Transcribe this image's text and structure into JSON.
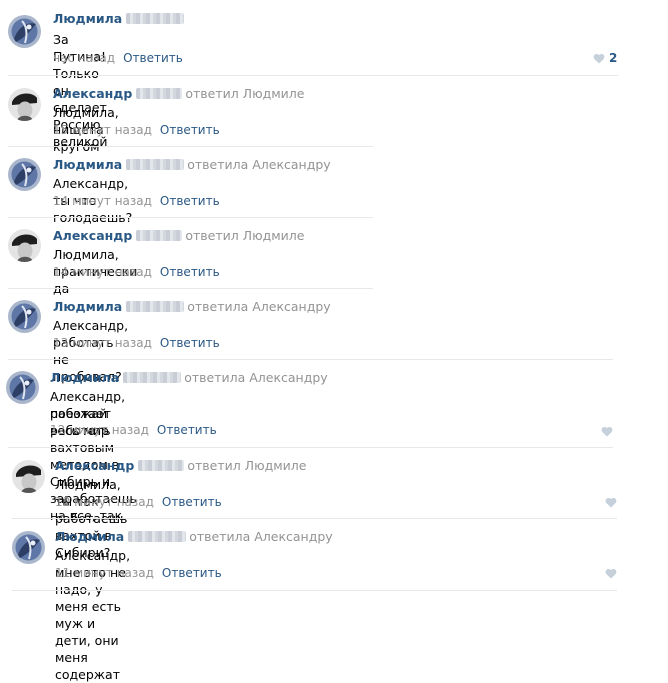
{
  "comments": [
    {
      "author": "Людмила",
      "reply_to": "",
      "text": "За Путина! Только он сделает Россию великой",
      "time": "час назад",
      "reply_label": "Ответить",
      "likes": "2",
      "avatar": "ludmila-avatar"
    },
    {
      "author": "Александр",
      "reply_to": "ответил Людмиле",
      "text": "Людмила, нищета кругом",
      "time": "15 минут назад",
      "reply_label": "Ответить",
      "avatar": "alexander-avatar"
    },
    {
      "author": "Людмила",
      "reply_to": "ответила Александру",
      "text": "Александр, ты что голодаешь?",
      "time": "14 минут назад",
      "reply_label": "Ответить",
      "avatar": "ludmila-avatar"
    },
    {
      "author": "Александр",
      "reply_to": "ответил Людмиле",
      "text": "Людмила, практически да",
      "time": "14 минут назад",
      "reply_label": "Ответить",
      "avatar": "alexander-avatar"
    },
    {
      "author": "Людмила",
      "reply_to": "ответила Александру",
      "text": "Александр, работать не пробовал?",
      "time": "13 минут назад",
      "reply_label": "Ответить",
      "avatar": "ludmila-avatar"
    },
    {
      "author": "Людмила",
      "reply_to": "ответила Александру",
      "text_line1": "Александр, поезжай работать вахтовым методом в Сибирь и заработаешь на все, так",
      "text_line2": "работает весь мир",
      "time": "12 минут назад",
      "reply_label": "Ответить",
      "avatar": "ludmila-avatar"
    },
    {
      "author": "Александр",
      "reply_to": "ответил Людмиле",
      "text": "Людмила, ты так работаешь вахтой в Сибири?",
      "time": "12 минут назад",
      "reply_label": "Ответить",
      "avatar": "alexander-avatar"
    },
    {
      "author": "Людмила",
      "reply_to": "ответила Александру",
      "text": "Александр, мне это не надо, у меня есть муж и дети, они меня содержат",
      "time": "11 минут назад",
      "reply_label": "Ответить",
      "avatar": "ludmila-avatar"
    }
  ],
  "colors": {
    "link": "#2a5885",
    "muted": "#939393",
    "divider": "#e7e8ec",
    "heart": "#c5d0db"
  }
}
